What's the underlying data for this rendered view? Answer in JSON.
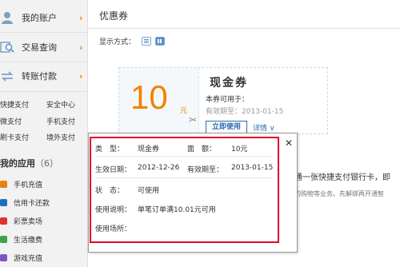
{
  "sidebar": {
    "nav": [
      {
        "label": "我的账户"
      },
      {
        "label": "交易查询"
      },
      {
        "label": "转账付款"
      }
    ],
    "quick_links": [
      "快捷支付",
      "安全中心",
      "微支付",
      "手机支付",
      "刷卡支付",
      "境外支付"
    ],
    "apps_title": "我的应用",
    "apps_count": "（6）",
    "apps": [
      {
        "label": "手机充值",
        "color": "#e8810e"
      },
      {
        "label": "信用卡还款",
        "color": "#1f6fbf"
      },
      {
        "label": "彩票卖场",
        "color": "#d9352b"
      },
      {
        "label": "生活缴费",
        "color": "#3aa34b"
      },
      {
        "label": "游戏充值",
        "color": "#7b57c2"
      }
    ]
  },
  "main": {
    "title": "优惠券",
    "display_mode_label": "显示方式："
  },
  "coupon": {
    "value": "10",
    "unit": "元",
    "type": "现金券",
    "usable_label": "本券可用于：",
    "validity": "有效期至：2013-01-15",
    "use_button": "立即使用",
    "details_link": "详情"
  },
  "banner": {
    "line1": "通一张快捷支付银行卡，即",
    "line2": "的购物等业务。先解绑再开通智"
  },
  "popup": {
    "type_label": "类　型：",
    "type_value": "现金券",
    "amount_label": "面　额：",
    "amount_value": "10元",
    "start_label": "生效日期：",
    "start_value": "2012-12-26",
    "end_label": "有效期至：",
    "end_value": "2013-01-15",
    "status_label": "状　态：",
    "status_value": "可使用",
    "desc_label": "使用说明：",
    "desc_value": "单笔订单满10.01元可用",
    "place_label": "使用场所：",
    "place_value": ""
  },
  "colors": {
    "accent": "#f08300",
    "link": "#2b6cb0",
    "highlight": "#e3002b"
  },
  "icons": {
    "account": "user-icon",
    "query": "search-icon",
    "transfer": "transfer-icon",
    "close": "close-icon",
    "scissors": "scissors-icon"
  }
}
